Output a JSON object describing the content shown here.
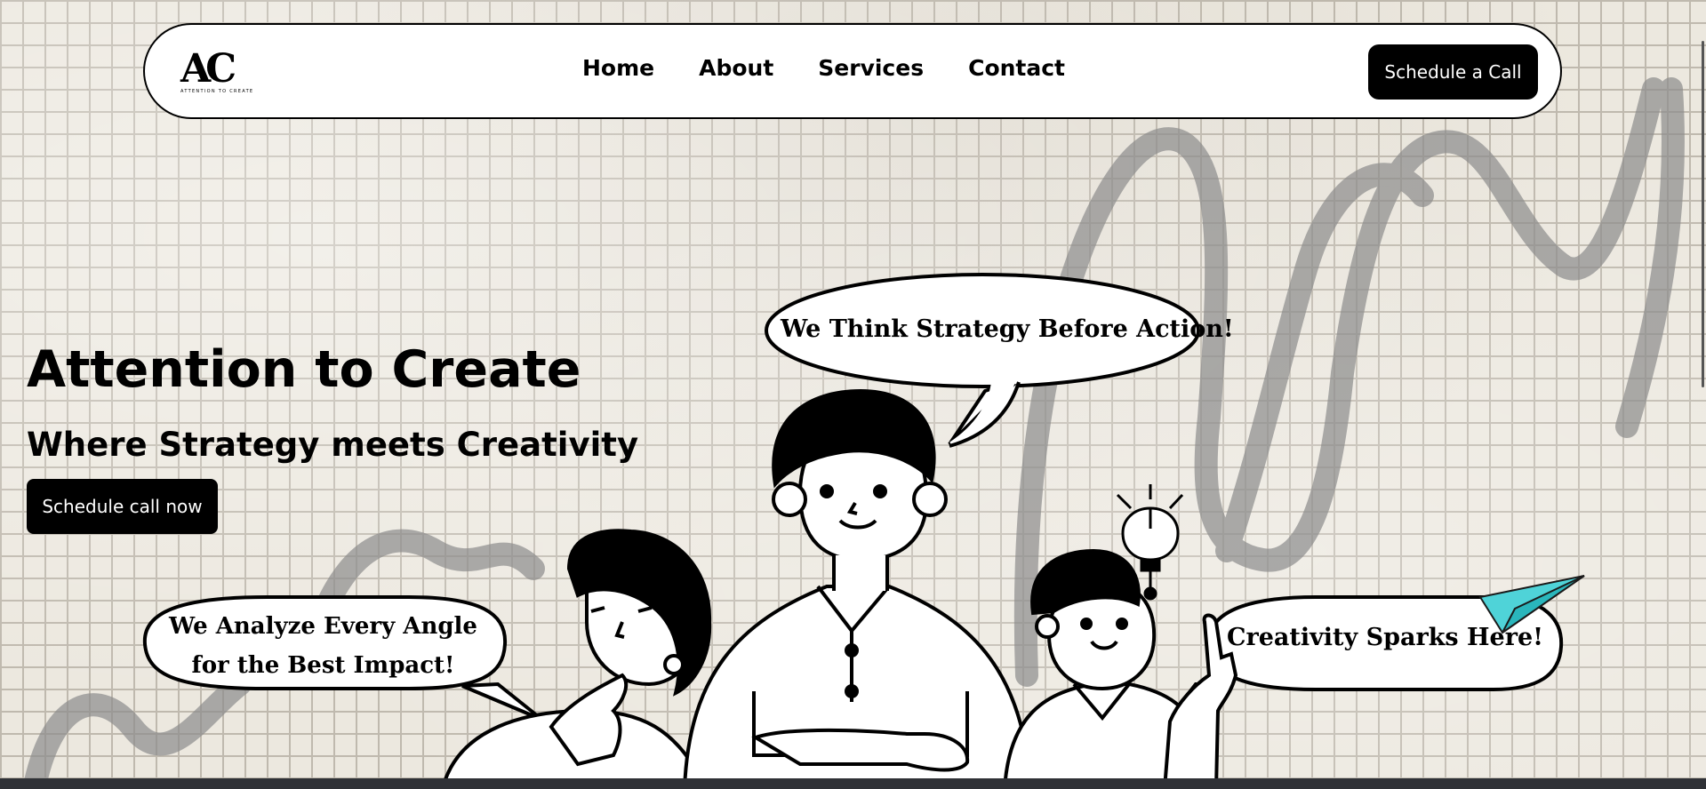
{
  "nav": {
    "logo_text": "AC",
    "logo_tagline": "ATTENTION TO CREATE",
    "links": [
      "Home",
      "About",
      "Services",
      "Contact"
    ],
    "cta_label": "Schedule a Call"
  },
  "hero": {
    "title": "Attention to Create",
    "subtitle": "Where Strategy meets Creativity",
    "cta_label": "Schedule call now"
  },
  "bubbles": {
    "strategy": "We Think Strategy Before Action!",
    "analyze_line1": "We Analyze Every Angle",
    "analyze_line2": "for the Best Impact!",
    "creativity": "Creativity Sparks Here!"
  },
  "colors": {
    "accent_plane": "#4fd3d8",
    "button_bg": "#000000",
    "scribble": "#8c8c8c"
  },
  "icons": [
    "lightbulb-icon",
    "paper-plane-icon"
  ]
}
